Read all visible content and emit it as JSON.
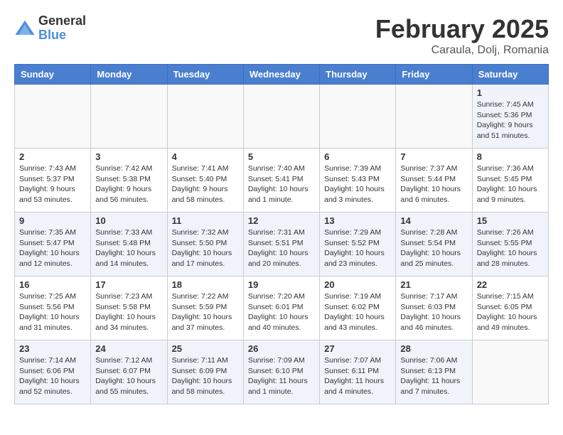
{
  "header": {
    "logo_general": "General",
    "logo_blue": "Blue",
    "month_title": "February 2025",
    "location": "Caraula, Dolj, Romania"
  },
  "weekdays": [
    "Sunday",
    "Monday",
    "Tuesday",
    "Wednesday",
    "Thursday",
    "Friday",
    "Saturday"
  ],
  "weeks": [
    [
      {
        "day": "",
        "info": ""
      },
      {
        "day": "",
        "info": ""
      },
      {
        "day": "",
        "info": ""
      },
      {
        "day": "",
        "info": ""
      },
      {
        "day": "",
        "info": ""
      },
      {
        "day": "",
        "info": ""
      },
      {
        "day": "1",
        "info": "Sunrise: 7:45 AM\nSunset: 5:36 PM\nDaylight: 9 hours and 51 minutes."
      }
    ],
    [
      {
        "day": "2",
        "info": "Sunrise: 7:43 AM\nSunset: 5:37 PM\nDaylight: 9 hours and 53 minutes."
      },
      {
        "day": "3",
        "info": "Sunrise: 7:42 AM\nSunset: 5:38 PM\nDaylight: 9 hours and 56 minutes."
      },
      {
        "day": "4",
        "info": "Sunrise: 7:41 AM\nSunset: 5:40 PM\nDaylight: 9 hours and 58 minutes."
      },
      {
        "day": "5",
        "info": "Sunrise: 7:40 AM\nSunset: 5:41 PM\nDaylight: 10 hours and 1 minute."
      },
      {
        "day": "6",
        "info": "Sunrise: 7:39 AM\nSunset: 5:43 PM\nDaylight: 10 hours and 3 minutes."
      },
      {
        "day": "7",
        "info": "Sunrise: 7:37 AM\nSunset: 5:44 PM\nDaylight: 10 hours and 6 minutes."
      },
      {
        "day": "8",
        "info": "Sunrise: 7:36 AM\nSunset: 5:45 PM\nDaylight: 10 hours and 9 minutes."
      }
    ],
    [
      {
        "day": "9",
        "info": "Sunrise: 7:35 AM\nSunset: 5:47 PM\nDaylight: 10 hours and 12 minutes."
      },
      {
        "day": "10",
        "info": "Sunrise: 7:33 AM\nSunset: 5:48 PM\nDaylight: 10 hours and 14 minutes."
      },
      {
        "day": "11",
        "info": "Sunrise: 7:32 AM\nSunset: 5:50 PM\nDaylight: 10 hours and 17 minutes."
      },
      {
        "day": "12",
        "info": "Sunrise: 7:31 AM\nSunset: 5:51 PM\nDaylight: 10 hours and 20 minutes."
      },
      {
        "day": "13",
        "info": "Sunrise: 7:29 AM\nSunset: 5:52 PM\nDaylight: 10 hours and 23 minutes."
      },
      {
        "day": "14",
        "info": "Sunrise: 7:28 AM\nSunset: 5:54 PM\nDaylight: 10 hours and 25 minutes."
      },
      {
        "day": "15",
        "info": "Sunrise: 7:26 AM\nSunset: 5:55 PM\nDaylight: 10 hours and 28 minutes."
      }
    ],
    [
      {
        "day": "16",
        "info": "Sunrise: 7:25 AM\nSunset: 5:56 PM\nDaylight: 10 hours and 31 minutes."
      },
      {
        "day": "17",
        "info": "Sunrise: 7:23 AM\nSunset: 5:58 PM\nDaylight: 10 hours and 34 minutes."
      },
      {
        "day": "18",
        "info": "Sunrise: 7:22 AM\nSunset: 5:59 PM\nDaylight: 10 hours and 37 minutes."
      },
      {
        "day": "19",
        "info": "Sunrise: 7:20 AM\nSunset: 6:01 PM\nDaylight: 10 hours and 40 minutes."
      },
      {
        "day": "20",
        "info": "Sunrise: 7:19 AM\nSunset: 6:02 PM\nDaylight: 10 hours and 43 minutes."
      },
      {
        "day": "21",
        "info": "Sunrise: 7:17 AM\nSunset: 6:03 PM\nDaylight: 10 hours and 46 minutes."
      },
      {
        "day": "22",
        "info": "Sunrise: 7:15 AM\nSunset: 6:05 PM\nDaylight: 10 hours and 49 minutes."
      }
    ],
    [
      {
        "day": "23",
        "info": "Sunrise: 7:14 AM\nSunset: 6:06 PM\nDaylight: 10 hours and 52 minutes."
      },
      {
        "day": "24",
        "info": "Sunrise: 7:12 AM\nSunset: 6:07 PM\nDaylight: 10 hours and 55 minutes."
      },
      {
        "day": "25",
        "info": "Sunrise: 7:11 AM\nSunset: 6:09 PM\nDaylight: 10 hours and 58 minutes."
      },
      {
        "day": "26",
        "info": "Sunrise: 7:09 AM\nSunset: 6:10 PM\nDaylight: 11 hours and 1 minute."
      },
      {
        "day": "27",
        "info": "Sunrise: 7:07 AM\nSunset: 6:11 PM\nDaylight: 11 hours and 4 minutes."
      },
      {
        "day": "28",
        "info": "Sunrise: 7:06 AM\nSunset: 6:13 PM\nDaylight: 11 hours and 7 minutes."
      },
      {
        "day": "",
        "info": ""
      }
    ]
  ]
}
